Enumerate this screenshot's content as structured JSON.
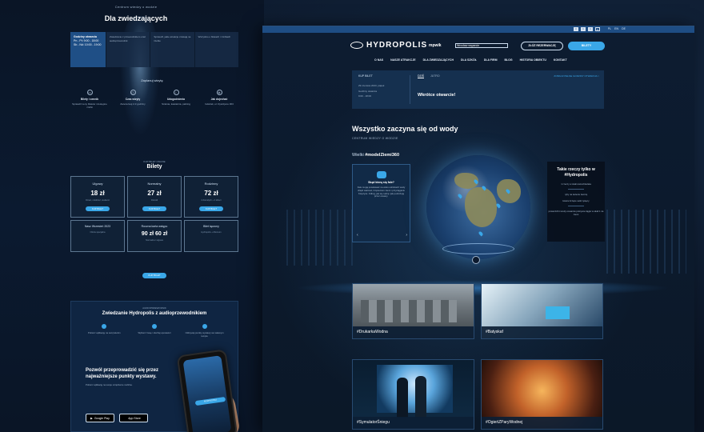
{
  "left_page": {
    "kicker": "Centrum wiedzy o wodzie",
    "title": "Dla zwiedzających",
    "hero": {
      "hours_title": "Godziny otwarcia",
      "hours_lines": [
        "Pn - Pt: 9:00 - 18:00",
        "Sb - Nd: 10:00 - 19:00"
      ],
      "col1": "Zwiedzanie z przewodnikiem oraz audioprzewodnik",
      "col2": "Sprawdź, jakie atrakcje czekają na Ciebie",
      "col3": "Wszystko o biletach i zniżkach"
    },
    "sub_heading": "Zaplanuj wizytę",
    "icons": [
      {
        "icon": "ticket-icon",
        "title": "Bilety i cennik",
        "text": "Sprawdź ceny biletów i dostępne zniżki"
      },
      {
        "icon": "clock-icon",
        "title": "Czas wizyty",
        "text": "Zarezerwuj 2-3 godziny"
      },
      {
        "icon": "info-icon",
        "title": "Udogodnienia",
        "text": "Szatnia, kawiarnia, parking"
      },
      {
        "icon": "map-icon",
        "title": "Jak dojechać",
        "text": "Gdańsk, ul. Dywizjonu 303"
      }
    ],
    "bilety_small": "KUP BILET ONLINE",
    "bilety_title": "Bilety",
    "tickets": [
      {
        "name": "Ulgowy",
        "price": "18 zł",
        "note": "Dzieci, młodzież, studenci"
      },
      {
        "name": "Normalny",
        "price": "27 zł",
        "note": "Dorośli"
      },
      {
        "name": "Rodzinny",
        "price": "72 zł",
        "note": "2 dorosłych + 2 dzieci"
      }
    ],
    "tickets2": [
      {
        "name": "Nasz Wrzesień 2023",
        "price": "",
        "note": "Oferta specjalna"
      },
      {
        "name": "Roczna karta wstępu",
        "price": "90 zł   60 zł",
        "note": "Normalna / ulgowa"
      },
      {
        "name": "Bilet łączony",
        "price": "",
        "note": "Hydropolis + Muzeum"
      }
    ],
    "buy_label": "KUP BILET",
    "audio": {
      "small": "AUDIOPRZEWODNIK",
      "title": "Zwiedzanie Hydropolis z audioprzewodnikiem",
      "items": [
        "Pobierz aplikację na swój telefon",
        "Wybierz trasę i słuchaj opowieści",
        "Odkrywaj punkty wystawy we własnym tempie"
      ],
      "cta_title": "Pozwól przeprowadzić się przez najważniejsze punkty wystawy.",
      "cta_text": "Pobierz aplikację na swoje urządzenie mobilne.",
      "store1": "Google Play",
      "store2": "App Store",
      "phone_btn": "ROZPOCZNIJ"
    }
  },
  "right_page": {
    "langs": [
      "PL",
      "EN",
      "DE"
    ],
    "logo": "HYDROPOLIS",
    "partner1": "mpwik",
    "partner2": "Wrocław  wsparcie",
    "btn_outline": "ZŁÓŻ REZERWACJĘ",
    "btn_filled": "BILETY",
    "nav": [
      "O NAS",
      "NASZE ATRAKCJE",
      "DLA ZWIEDZAJĄCYCH",
      "DLA SZKÓŁ",
      "DLA FIRM",
      "BLOG",
      "HISTORIA OBIEKTU",
      "KONTAKT"
    ],
    "info": {
      "label": "KUP BILET",
      "date": "29 czerwca 2023, piątek",
      "hours_label": "Godziny otwarcia",
      "hours": "9:00 - 18:00",
      "tab1": "DZIŚ",
      "tab2": "JUTRO",
      "status": "Wkrótce otwarcie!",
      "link": "ZOBACZ PEŁNE GODZINY OTWARCIA  >"
    },
    "heading": "Wszystko zaczyna się od wody",
    "heading_sub": "CENTRUM WIEDZY O WODZIE",
    "wielki_prefix": "Wielki",
    "wielki_tag": "#modelZiemi360",
    "fact": {
      "title": "Skąd biorą się fale?",
      "text": "Fale mogą powstawać na wielu odcinkach wody dzięki wiatrowi, trzęsieniom ziemi i przyciąganiu Księżyca. Odkryj, jak się rodzą i jak podróżują przez oceany."
    },
    "side": {
      "title": "Takie rzeczy tylko w #Hydropolis",
      "p1": "1 rzeczy w skali wszechświata",
      "p2": "ryby na świecie tworzą",
      "p3": "ławice liczące setki tysięcy",
      "p4": "powierzchni wody oceanów pokrywa ciągle w skali 1 na ziemi"
    },
    "tiles": [
      "#DrukarkaWodna",
      "#Batyskaf",
      "#SymulatorŚniegu",
      "#OgieńZParyWodnej"
    ]
  }
}
